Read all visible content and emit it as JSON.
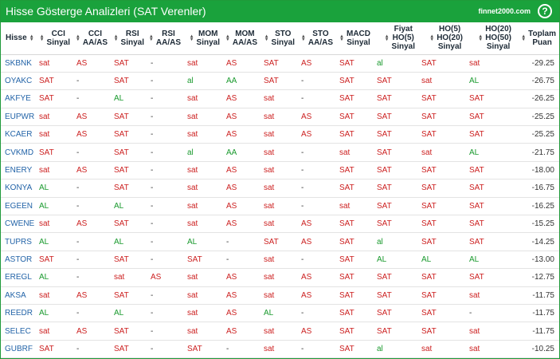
{
  "header": {
    "title": "Hisse Gösterge Analizleri (SAT Verenler)",
    "site": "finnet2000.com",
    "help_label": "?"
  },
  "colors": {
    "accent": "#1aa23c",
    "sell": "#cc1f1f",
    "buy": "#1a9a2e",
    "link": "#2364a8"
  },
  "sort_icons": {
    "up": "▲",
    "down": "▼"
  },
  "columns": [
    {
      "lines": [
        "Hisse"
      ]
    },
    {
      "lines": [
        "CCI",
        "Sinyal"
      ]
    },
    {
      "lines": [
        "CCI",
        "AA/AS"
      ]
    },
    {
      "lines": [
        "RSI",
        "Sinyal"
      ]
    },
    {
      "lines": [
        "RSI",
        "AA/AS"
      ]
    },
    {
      "lines": [
        "MOM",
        "Sinyal"
      ]
    },
    {
      "lines": [
        "MOM",
        "AA/AS"
      ]
    },
    {
      "lines": [
        "STO",
        "Sinyal"
      ]
    },
    {
      "lines": [
        "STO",
        "AA/AS"
      ]
    },
    {
      "lines": [
        "MACD",
        "Sinyal"
      ]
    },
    {
      "lines": [
        "Fiyat",
        "HO(5)",
        "Sinyal"
      ]
    },
    {
      "lines": [
        "HO(5)",
        "HO(20)",
        "Sinyal"
      ]
    },
    {
      "lines": [
        "HO(20)",
        "HO(50)",
        "Sinyal"
      ]
    },
    {
      "lines": [
        "Toplam",
        "Puan"
      ]
    }
  ],
  "rows": [
    [
      "SKBNK",
      "sat",
      "AS",
      "SAT",
      "-",
      "sat",
      "AS",
      "SAT",
      "AS",
      "SAT",
      "al",
      "SAT",
      "sat",
      "-29.25"
    ],
    [
      "OYAKC",
      "SAT",
      "-",
      "SAT",
      "-",
      "al",
      "AA",
      "SAT",
      "-",
      "SAT",
      "SAT",
      "sat",
      "AL",
      "-26.75"
    ],
    [
      "AKFYE",
      "SAT",
      "-",
      "AL",
      "-",
      "sat",
      "AS",
      "sat",
      "-",
      "SAT",
      "SAT",
      "SAT",
      "SAT",
      "-26.25"
    ],
    [
      "EUPWR",
      "sat",
      "AS",
      "SAT",
      "-",
      "sat",
      "AS",
      "sat",
      "AS",
      "SAT",
      "SAT",
      "SAT",
      "SAT",
      "-25.25"
    ],
    [
      "KCAER",
      "sat",
      "AS",
      "SAT",
      "-",
      "sat",
      "AS",
      "sat",
      "AS",
      "SAT",
      "SAT",
      "SAT",
      "SAT",
      "-25.25"
    ],
    [
      "CVKMD",
      "SAT",
      "-",
      "SAT",
      "-",
      "al",
      "AA",
      "sat",
      "-",
      "sat",
      "SAT",
      "sat",
      "AL",
      "-21.75"
    ],
    [
      "ENERY",
      "sat",
      "AS",
      "SAT",
      "-",
      "sat",
      "AS",
      "sat",
      "-",
      "SAT",
      "SAT",
      "SAT",
      "SAT",
      "-18.00"
    ],
    [
      "KONYA",
      "AL",
      "-",
      "SAT",
      "-",
      "sat",
      "AS",
      "sat",
      "-",
      "SAT",
      "SAT",
      "SAT",
      "SAT",
      "-16.75"
    ],
    [
      "EGEEN",
      "AL",
      "-",
      "AL",
      "-",
      "sat",
      "AS",
      "sat",
      "-",
      "sat",
      "SAT",
      "SAT",
      "SAT",
      "-16.25"
    ],
    [
      "CWENE",
      "sat",
      "AS",
      "SAT",
      "-",
      "sat",
      "AS",
      "sat",
      "AS",
      "SAT",
      "SAT",
      "SAT",
      "SAT",
      "-15.25"
    ],
    [
      "TUPRS",
      "AL",
      "-",
      "AL",
      "-",
      "AL",
      "-",
      "SAT",
      "AS",
      "SAT",
      "al",
      "SAT",
      "SAT",
      "-14.25"
    ],
    [
      "ASTOR",
      "SAT",
      "-",
      "SAT",
      "-",
      "SAT",
      "-",
      "sat",
      "-",
      "SAT",
      "AL",
      "AL",
      "AL",
      "-13.00"
    ],
    [
      "EREGL",
      "AL",
      "-",
      "sat",
      "AS",
      "sat",
      "AS",
      "sat",
      "AS",
      "SAT",
      "SAT",
      "SAT",
      "SAT",
      "-12.75"
    ],
    [
      "AKSA",
      "sat",
      "AS",
      "SAT",
      "-",
      "sat",
      "AS",
      "sat",
      "AS",
      "SAT",
      "SAT",
      "SAT",
      "sat",
      "-11.75"
    ],
    [
      "REEDR",
      "AL",
      "-",
      "AL",
      "-",
      "sat",
      "AS",
      "AL",
      "-",
      "SAT",
      "SAT",
      "SAT",
      "-",
      "-11.75"
    ],
    [
      "SELEC",
      "sat",
      "AS",
      "SAT",
      "-",
      "sat",
      "AS",
      "sat",
      "AS",
      "SAT",
      "SAT",
      "SAT",
      "sat",
      "-11.75"
    ],
    [
      "GUBRF",
      "SAT",
      "-",
      "SAT",
      "-",
      "SAT",
      "-",
      "sat",
      "-",
      "SAT",
      "al",
      "sat",
      "sat",
      "-10.25"
    ]
  ]
}
